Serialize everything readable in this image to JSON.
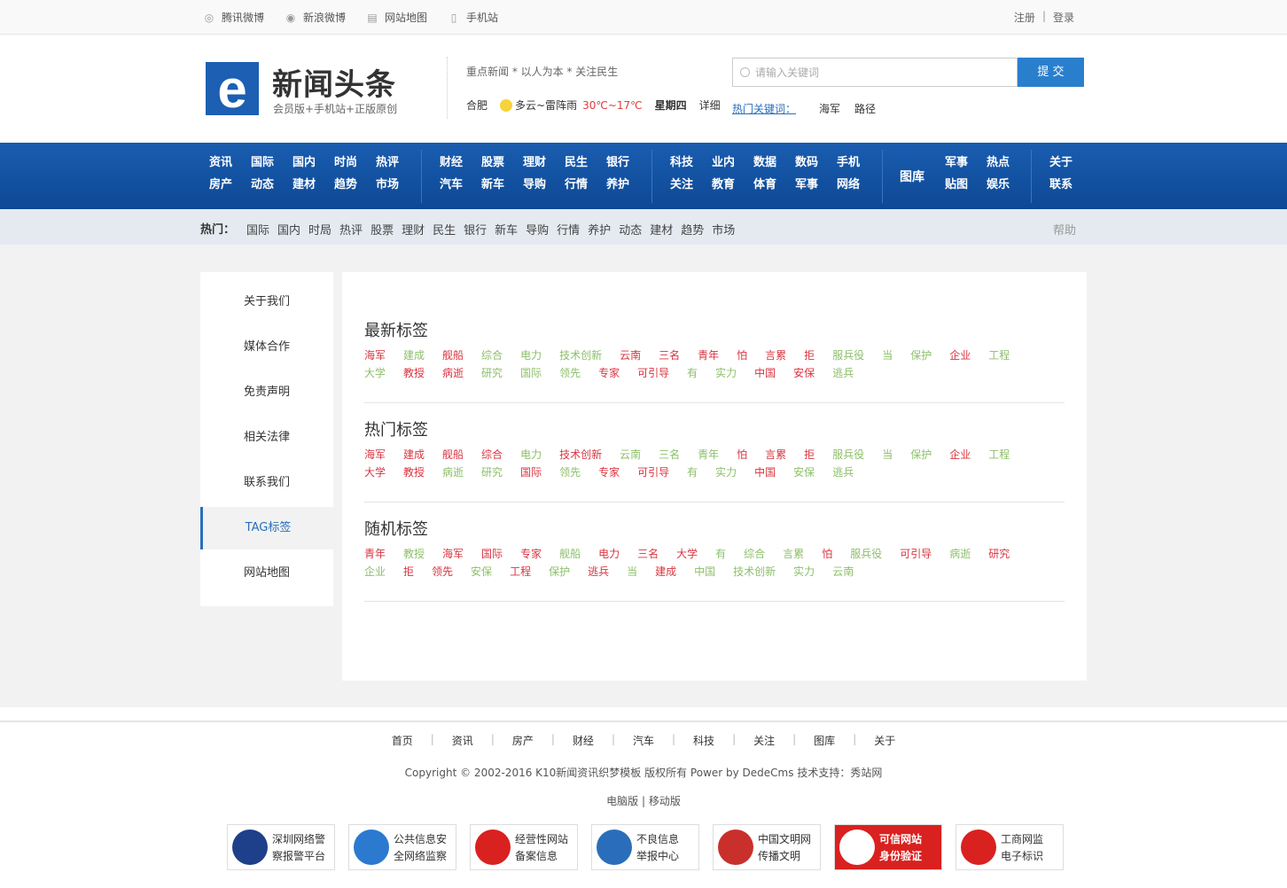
{
  "topbar": {
    "links": [
      {
        "icon": "weibo-tencent-icon",
        "label": "腾讯微博"
      },
      {
        "icon": "weibo-sina-icon",
        "label": "新浪微博"
      },
      {
        "icon": "sitemap-icon",
        "label": "网站地图"
      },
      {
        "icon": "mobile-icon",
        "label": "手机站"
      }
    ],
    "register": "注册",
    "separator": "|",
    "login": "登录"
  },
  "header": {
    "logo_letter": "e",
    "title": "新闻头条",
    "subtitle": "会员版+手机站+正版原创",
    "slogan": "重点新闻 * 以人为本 * 关注民生",
    "weather": {
      "city": "合肥",
      "desc": "多云~雷阵雨",
      "temp": "30℃~17℃",
      "weekday": "星期四",
      "detail": "详细"
    },
    "search": {
      "placeholder": "请输入关键词",
      "button": "提 交"
    },
    "hot_keywords": {
      "label": "热门关键词：",
      "items": [
        "海军",
        "路径"
      ]
    }
  },
  "nav": {
    "group1": [
      "资讯",
      "国际",
      "国内",
      "时尚",
      "热评",
      "房产",
      "动态",
      "建材",
      "趋势",
      "市场"
    ],
    "group2": [
      "财经",
      "股票",
      "理财",
      "民生",
      "银行",
      "汽车",
      "新车",
      "导购",
      "行情",
      "养护"
    ],
    "group3": [
      "科技",
      "业内",
      "数据",
      "数码",
      "手机",
      "关注",
      "教育",
      "体育",
      "军事",
      "网络"
    ],
    "pics": "图库",
    "group4": [
      "军事",
      "热点",
      "贴图",
      "娱乐"
    ],
    "group5": [
      "关于",
      "联系"
    ]
  },
  "hotbar": {
    "label": "热门：",
    "items": [
      "国际",
      "国内",
      "时局",
      "热评",
      "股票",
      "理财",
      "民生",
      "银行",
      "新车",
      "导购",
      "行情",
      "养护",
      "动态",
      "建材",
      "趋势",
      "市场"
    ],
    "help": "帮助"
  },
  "sidebar": [
    "关于我们",
    "媒体合作",
    "免责声明",
    "相关法律",
    "联系我们",
    "TAG标签",
    "网站地图"
  ],
  "sections": [
    {
      "title": "最新标签",
      "tags": [
        "海军",
        "建成",
        "舰船",
        "综合",
        "电力",
        "技术创新",
        "云南",
        "三名",
        "青年",
        "怕",
        "言累",
        "拒",
        "服兵役",
        "当",
        "保护",
        "企业",
        "工程",
        "大学",
        "教授",
        "病逝",
        "研究",
        "国际",
        "领先",
        "专家",
        "可引导",
        "有",
        "实力",
        "中国",
        "安保",
        "逃兵"
      ]
    },
    {
      "title": "热门标签",
      "tags": [
        "海军",
        "建成",
        "舰船",
        "综合",
        "电力",
        "技术创新",
        "云南",
        "三名",
        "青年",
        "怕",
        "言累",
        "拒",
        "服兵役",
        "当",
        "保护",
        "企业",
        "工程",
        "大学",
        "教授",
        "病逝",
        "研究",
        "国际",
        "领先",
        "专家",
        "可引导",
        "有",
        "实力",
        "中国",
        "安保",
        "逃兵"
      ]
    },
    {
      "title": "随机标签",
      "tags": [
        "青年",
        "教授",
        "海军",
        "国际",
        "专家",
        "舰船",
        "电力",
        "三名",
        "大学",
        "有",
        "综合",
        "言累",
        "怕",
        "服兵役",
        "可引导",
        "病逝",
        "研究",
        "企业",
        "拒",
        "领先",
        "安保",
        "工程",
        "保护",
        "逃兵",
        "当",
        "建成",
        "中国",
        "技术创新",
        "实力",
        "云南"
      ]
    }
  ],
  "tag_colors": {
    "red": "#d9343f",
    "green": "#8cbf6a"
  },
  "footer": {
    "nav": [
      "首页",
      "资讯",
      "房产",
      "财经",
      "汽车",
      "科技",
      "关注",
      "图库",
      "关于"
    ],
    "copyright": "Copyright © 2002-2016 K10新闻资讯织梦模板 版权所有 Power by DedeCms  技术支持：秀站网",
    "versions": "电脑版 | 移动版",
    "badges": [
      {
        "line1": "深圳网络警",
        "line2": "察报警平台"
      },
      {
        "line1": "公共信息安",
        "line2": "全网络监察"
      },
      {
        "line1": "经营性网站",
        "line2": "备案信息"
      },
      {
        "line1": "不良信息",
        "line2": "举报中心"
      },
      {
        "line1": "中国文明网",
        "line2": "传播文明"
      },
      {
        "line1": "可信网站",
        "line2": "身份验证"
      },
      {
        "line1": "工商网监",
        "line2": "电子标识"
      }
    ]
  }
}
